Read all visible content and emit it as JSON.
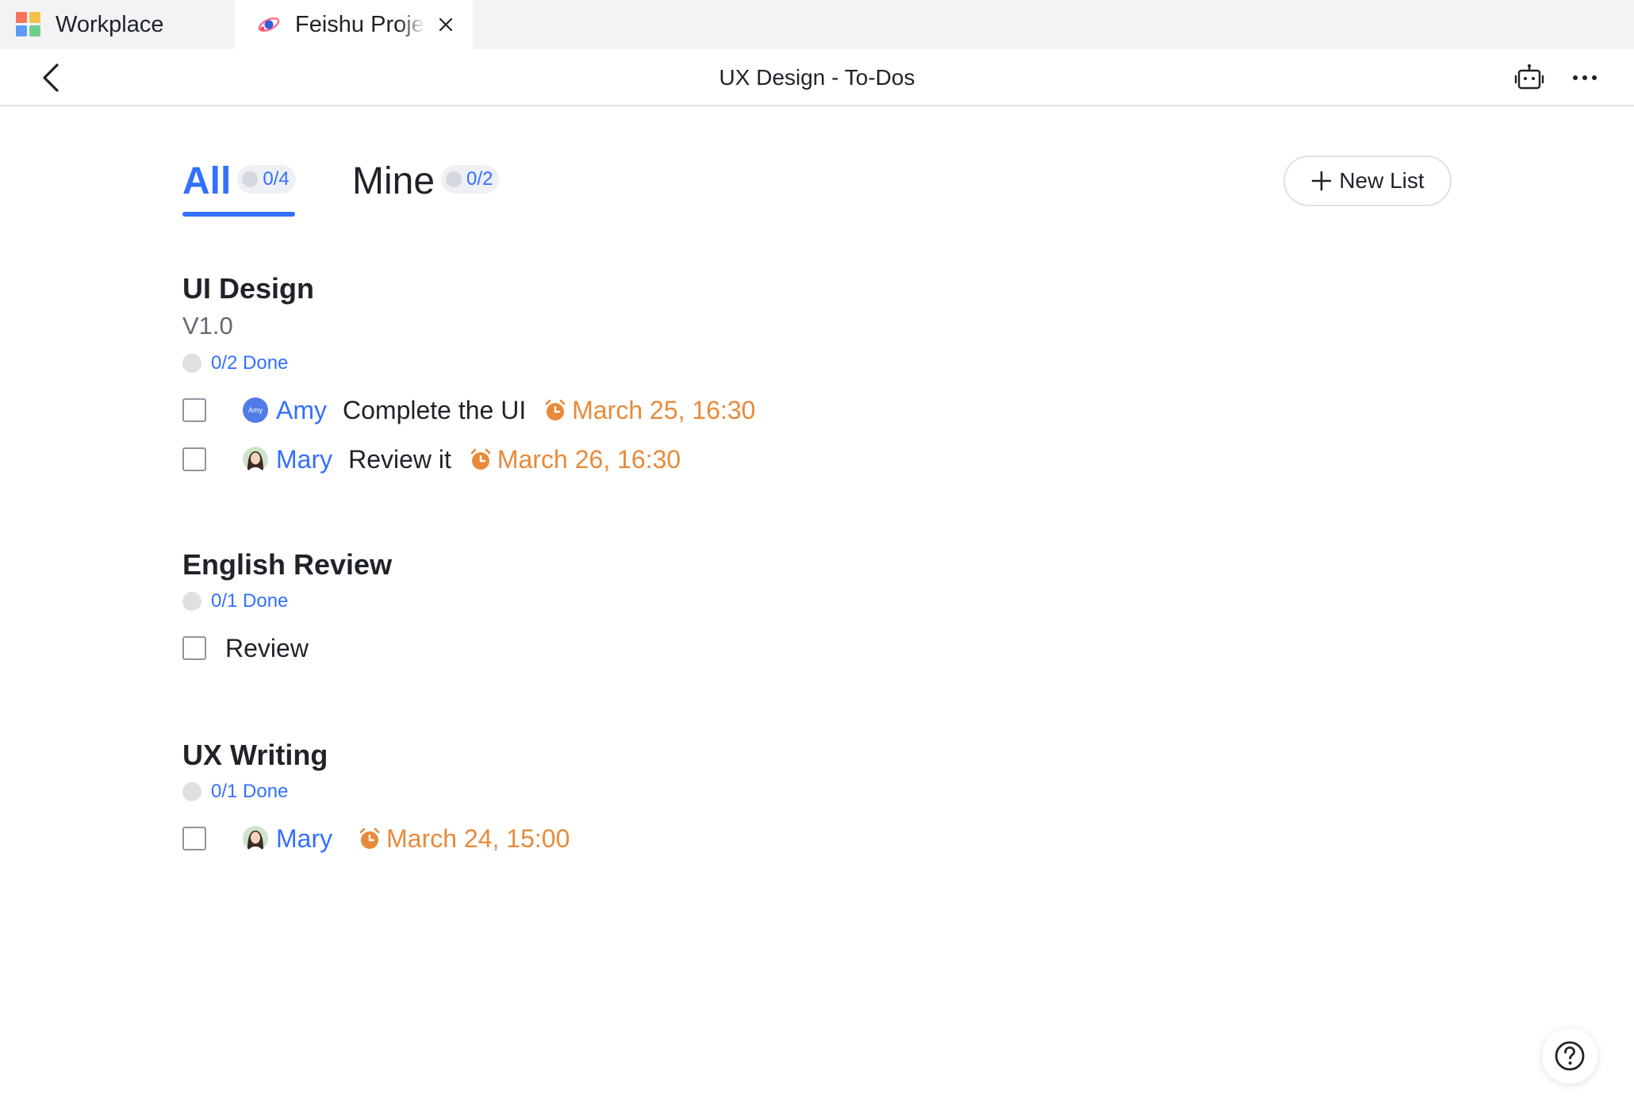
{
  "tabs": [
    {
      "label": "Workplace",
      "icon": "workplace-grid-icon"
    },
    {
      "label": "Feishu Project",
      "icon": "feishu-project-icon",
      "active": true
    }
  ],
  "header": {
    "title": "UX Design - To-Dos",
    "icons": [
      "back-arrow-icon",
      "bot-icon",
      "more-icon"
    ]
  },
  "filters": {
    "all": {
      "label": "All",
      "count": "0/4"
    },
    "mine": {
      "label": "Mine",
      "count": "0/2"
    },
    "active": "all"
  },
  "new_list_label": "New List",
  "sections": [
    {
      "title": "UI Design",
      "subtitle": "V1.0",
      "progress": "0/2 Done",
      "tasks": [
        {
          "assignee": "Amy",
          "avatar_text": "Amy",
          "text": "Complete the UI",
          "due": "March 25, 16:30"
        },
        {
          "assignee": "Mary",
          "text": "Review it",
          "due": "March 26, 16:30"
        }
      ]
    },
    {
      "title": "English Review",
      "progress": "0/1 Done",
      "tasks": [
        {
          "text": "Review"
        }
      ]
    },
    {
      "title": "UX Writing",
      "progress": "0/1 Done",
      "tasks": [
        {
          "assignee": "Mary",
          "due": "March 24, 15:00"
        }
      ]
    }
  ],
  "colors": {
    "accent": "#3370ff",
    "due": "#e88a3a",
    "text": "#1f2329",
    "muted": "#646a73"
  }
}
